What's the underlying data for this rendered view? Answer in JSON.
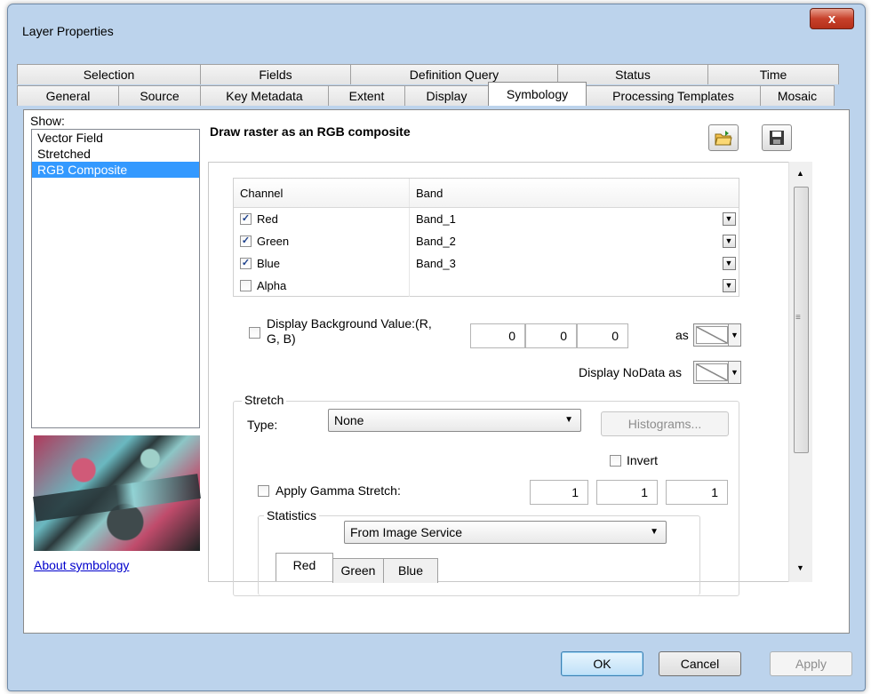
{
  "window": {
    "title": "Layer Properties",
    "close_label": "x"
  },
  "tabs_row1": [
    "Selection",
    "Fields",
    "Definition Query",
    "Status",
    "Time"
  ],
  "tabs_row2": [
    "General",
    "Source",
    "Key Metadata",
    "Extent",
    "Display",
    "Symbology",
    "Processing Templates",
    "Mosaic"
  ],
  "active_tab": "Symbology",
  "show": {
    "label": "Show:",
    "items": [
      "Vector Field",
      "Stretched",
      "RGB Composite"
    ],
    "selected": "RGB Composite"
  },
  "about_link": "About symbology",
  "heading": "Draw raster as an RGB composite",
  "grid": {
    "headers": [
      "Channel",
      "Band"
    ],
    "rows": [
      {
        "channel": "Red",
        "checked": true,
        "band": "Band_1"
      },
      {
        "channel": "Green",
        "checked": true,
        "band": "Band_2"
      },
      {
        "channel": "Blue",
        "checked": true,
        "band": "Band_3"
      },
      {
        "channel": "Alpha",
        "checked": false,
        "band": ""
      }
    ]
  },
  "background": {
    "label_line1": "Display Background Value:(R,",
    "label_line2": "G, B)",
    "values": [
      "0",
      "0",
      "0"
    ],
    "as_label": "as"
  },
  "nodata_label": "Display NoData as",
  "stretch": {
    "group_label": "Stretch",
    "type_label": "Type:",
    "type_value": "None",
    "histograms_label": "Histograms...",
    "invert_label": "Invert",
    "gamma_label": "Apply Gamma Stretch:",
    "gamma_values": [
      "1",
      "1",
      "1"
    ]
  },
  "statistics": {
    "group_label": "Statistics",
    "value": "From Image Service",
    "subtabs": [
      "Red",
      "Green",
      "Blue"
    ]
  },
  "buttons": {
    "ok": "OK",
    "cancel": "Cancel",
    "apply": "Apply"
  },
  "icons": [
    "open-folder-icon",
    "save-disk-icon"
  ]
}
